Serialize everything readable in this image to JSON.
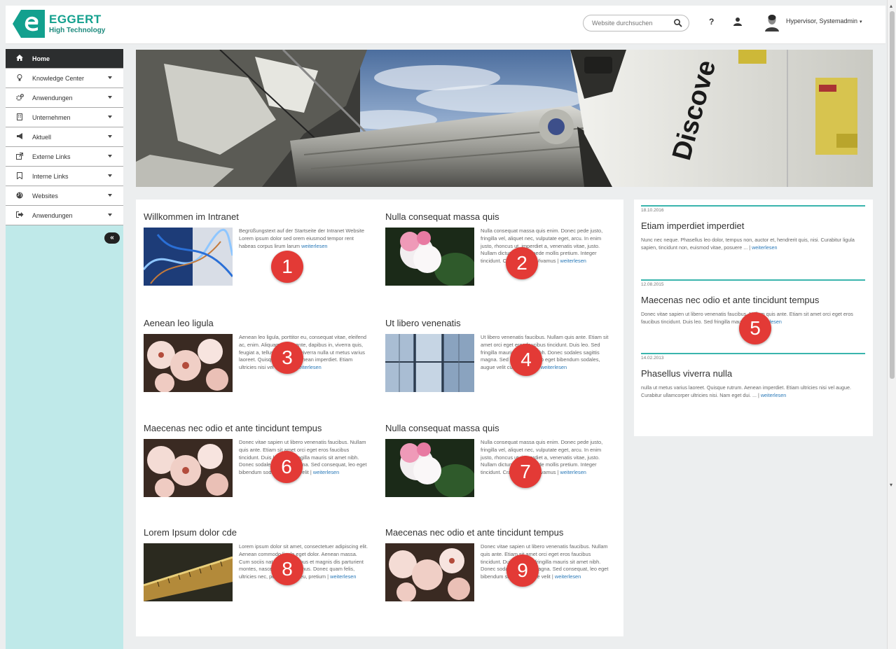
{
  "header": {
    "logo_name": "EGGERT",
    "logo_tagline": "High Technology",
    "search_placeholder": "Website durchsuchen",
    "help_label": "?",
    "user_name": "Hypervisor, Systemadmin",
    "user_caret": "▾"
  },
  "sidebar": {
    "items": [
      {
        "label": "Home",
        "icon": "home-icon"
      },
      {
        "label": "Knowledge Center",
        "icon": "lightbulb-icon"
      },
      {
        "label": "Anwendungen",
        "icon": "cogs-icon"
      },
      {
        "label": "Unternehmen",
        "icon": "building-icon"
      },
      {
        "label": "Aktuell",
        "icon": "megaphone-icon"
      },
      {
        "label": "Externe Links",
        "icon": "external-link-icon"
      },
      {
        "label": "Interne Links",
        "icon": "bookmark-icon"
      },
      {
        "label": "Websites",
        "icon": "globe-icon"
      },
      {
        "label": "Anwendungen",
        "icon": "sign-out-icon"
      }
    ],
    "collapse_label": "«"
  },
  "articles": [
    {
      "title": "Willkommen im Intranet",
      "text": "Begrüßungstext auf der Startseite der Intranet Website Lorem ipsum dolor sed orem eiusmod tempor rent habeas corpus lirum larum",
      "more": "weiterlesen"
    },
    {
      "title": "Nulla consequat massa quis",
      "text": "Nulla consequat massa quis enim. Donec pede justo, fringilla vel, aliquet nec, vulputate eget, arcu. In enim justo, rhoncus ut, imperdiet a, venenatis vitae, justo. Nullam dictum felis eu pede mollis pretium. Integer tincidunt. Cras dapibus. Vivamus |",
      "more": "weiterlesen"
    },
    {
      "title": "Aenean leo ligula",
      "text": "Aenean leo ligula, porttitor eu, consequat vitae, eleifend ac, enim. Aliquam lorem ante, dapibus in, viverra quis, feugiat a, tellus. Phasellus viverra nulla ut metus varius laoreet. Quisque rutrum. Aenean imperdiet. Etiam ultricies nisi vel augue. |",
      "more": "weiterlesen"
    },
    {
      "title": "Ut libero venenatis",
      "text": "Ut libero venenatis faucibus. Nullam quis ante. Etiam sit amet orci eget eros faucibus tincidunt. Duis leo. Sed fringilla mauris sit amet nibh. Donec sodales sagittis magna. Sed consequat, leo eget bibendum sodales, augue velit cursus nunc. |",
      "more": "weiterlesen"
    },
    {
      "title": "Maecenas nec odio et ante tincidunt tempus",
      "text": "Donec vitae sapien ut libero venenatis faucibus. Nullam quis ante. Etiam sit amet orci eget eros faucibus tincidunt. Duis leo. Sed fringilla mauris sit amet nibh. Donec sodales sagittis magna. Sed consequat, leo eget bibendum sodales, augue velit |",
      "more": "weiterlesen"
    },
    {
      "title": "Nulla consequat massa quis",
      "text": "Nulla consequat massa quis enim. Donec pede justo, fringilla vel, aliquet nec, vulputate eget, arcu. In enim justo, rhoncus ut, imperdiet a, venenatis vitae, justo. Nullam dictum felis eu pede mollis pretium. Integer tincidunt. Cras dapibus. Vivamus |",
      "more": "weiterlesen"
    },
    {
      "title": "Lorem Ipsum dolor cde",
      "text": "Lorem ipsum dolor sit amet, consectetuer adipiscing elit. Aenean commodo ligula eget dolor. Aenean massa. Cum sociis natoque penatibus et magnis dis parturient montes, nascetur ridiculus mus. Donec quam felis, ultricies nec, pellentesque eu, pretium |",
      "more": "weiterlesen"
    },
    {
      "title": "Maecenas nec odio et ante tincidunt tempus",
      "text": "Donec vitae sapien ut libero venenatis faucibus. Nullam quis ante. Etiam sit amet orci eget eros faucibus tincidunt. Duis leo. Sed fringilla mauris sit amet nibh. Donec sodales sagittis magna. Sed consequat, leo eget bibendum sodales, augue velit |",
      "more": "weiterlesen"
    }
  ],
  "news": [
    {
      "date": "18.10.2016",
      "title": "Etiam imperdiet imperdiet",
      "text": "Nunc nec neque. Phasellus leo dolor, tempus non, auctor et, hendrerit quis, nisi. Curabitur ligula sapien, tincidunt non, euismod vitae, posuere ... |",
      "more": "weiterlesen"
    },
    {
      "date": "12.08.2015",
      "title": "Maecenas nec odio et ante tincidunt tempus",
      "text": "Donec vitae sapien ut libero venenatis faucibus. Nullam quis ante. Etiam sit amet orci eget eros faucibus tincidunt. Duis leo. Sed fringilla mauris ... |",
      "more": "weiterlesen"
    },
    {
      "date": "14.02.2013",
      "title": "Phasellus viverra nulla",
      "text": "nulla ut metus varius laoreet. Quisque rutrum. Aenean imperdiet. Etiam ultricies nisi vel augue. Curabitur ullamcorper ultricies nisi. Nam eget dui. ... |",
      "more": "weiterlesen"
    }
  ],
  "badges": [
    "1",
    "2",
    "3",
    "4",
    "5",
    "6",
    "7",
    "8",
    "9"
  ],
  "colors": {
    "accent": "#13a08e",
    "sidebar_bg": "#bfe9e9",
    "active_nav": "#2c2e2f",
    "badge": "#e33a36",
    "link": "#2a79b8"
  }
}
